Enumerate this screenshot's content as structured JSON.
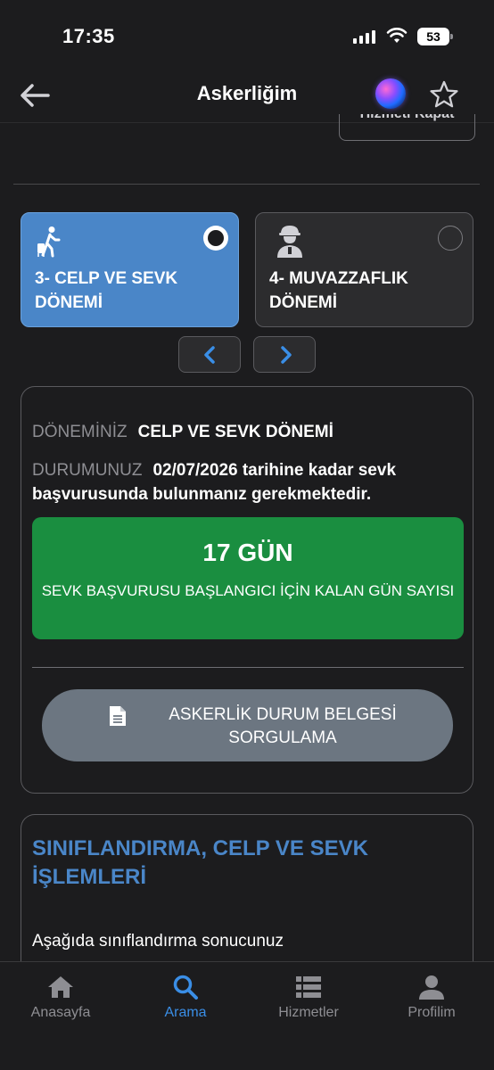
{
  "status_bar": {
    "time": "17:35",
    "battery": "53"
  },
  "nav": {
    "title": "Askerliğim",
    "back_icon": "back-arrow-icon",
    "siri_icon": "siri-icon",
    "favorite_icon": "star-icon"
  },
  "top_clipped_button": "Hizmeti Kapat",
  "periods": [
    {
      "label_line1": "3- CELP VE SEVK",
      "label_line2": "DÖNEMİ",
      "selected": true,
      "icon": "walking-person-icon"
    },
    {
      "label_line1": "4- MUVAZZAFLIK",
      "label_line2": "DÖNEMİ",
      "selected": false,
      "icon": "soldier-icon"
    }
  ],
  "status": {
    "period_label": "DÖNEMİNİZ",
    "period_value": "CELP VE SEVK DÖNEMİ",
    "state_label": "DURUMUNUZ",
    "state_value": "02/07/2026 tarihine kadar sevk başvurusunda bulunmanız gerekmektedir.",
    "countdown_value": "17 GÜN",
    "countdown_desc": "SEVK BAŞVURUSU BAŞLANGICI İÇİN KALAN GÜN SAYISI",
    "query_button_line1": "ASKERLİK DURUM BELGESİ",
    "query_button_line2": "SORGULAMA"
  },
  "section": {
    "title_line1": "SINIFLANDIRMA, CELP VE SEVK",
    "title_line2": "İŞLEMLERİ",
    "body": "Aşağıda sınıflandırma sonucunuz"
  },
  "tabs": [
    {
      "label": "Anasayfa",
      "icon": "home-icon",
      "active": false
    },
    {
      "label": "Arama",
      "icon": "search-icon",
      "active": true
    },
    {
      "label": "Hizmetler",
      "icon": "list-icon",
      "active": false
    },
    {
      "label": "Profilim",
      "icon": "person-icon",
      "active": false
    }
  ],
  "colors": {
    "accent": "#4a86c8",
    "countdown_green": "#1a8e40",
    "active_tab": "#3a8ee6",
    "background": "#1c1c1e"
  }
}
